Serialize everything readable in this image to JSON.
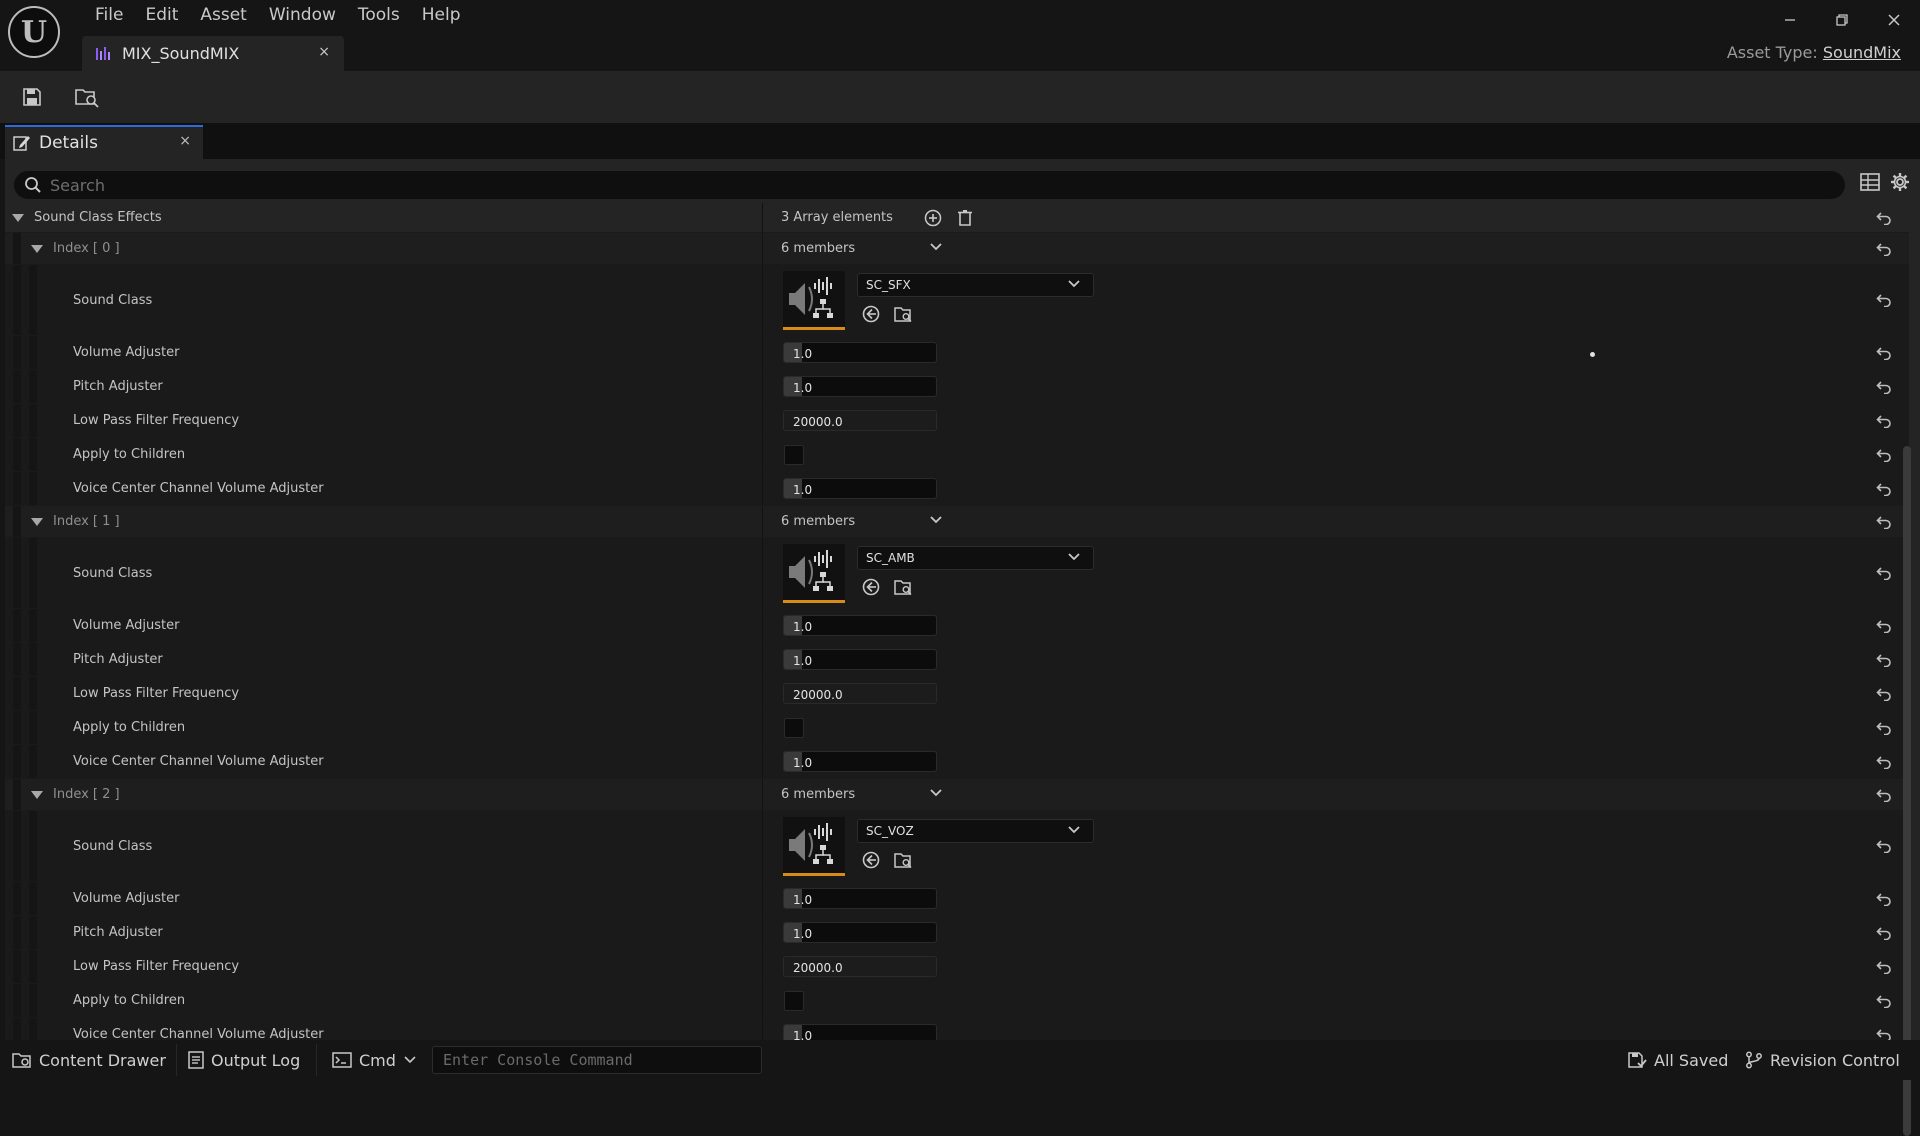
{
  "window": {
    "menu": [
      "File",
      "Edit",
      "Asset",
      "Window",
      "Tools",
      "Help"
    ],
    "doc_tab": {
      "label": "MIX_SoundMIX",
      "close": "×"
    },
    "asset_type_label": "Asset Type:",
    "asset_type_value": "SoundMix"
  },
  "details": {
    "tab_label": "Details",
    "tab_close": "×",
    "search_placeholder": "Search",
    "category": {
      "label": "Sound Class Effects",
      "value": "3 Array elements"
    },
    "row_labels": {
      "sound_class": "Sound Class",
      "volume": "Volume Adjuster",
      "pitch": "Pitch Adjuster",
      "lpf": "Low Pass Filter Frequency",
      "apply_children": "Apply to Children",
      "voice_center": "Voice Center Channel Volume Adjuster"
    },
    "elements": [
      {
        "index_label": "Index [ 0 ]",
        "members": "6 members",
        "sound_class": "SC_SFX",
        "volume": "1.0",
        "pitch": "1.0",
        "lpf": "20000.0",
        "apply_to_children": false,
        "voice_center": "1.0"
      },
      {
        "index_label": "Index [ 1 ]",
        "members": "6 members",
        "sound_class": "SC_AMB",
        "volume": "1.0",
        "pitch": "1.0",
        "lpf": "20000.0",
        "apply_to_children": false,
        "voice_center": "1.0"
      },
      {
        "index_label": "Index [ 2 ]",
        "members": "6 members",
        "sound_class": "SC_VOZ",
        "volume": "1.0",
        "pitch": "1.0",
        "lpf": "20000.0",
        "apply_to_children": false,
        "voice_center": "1.0"
      }
    ]
  },
  "statusbar": {
    "content_drawer": "Content Drawer",
    "output_log": "Output Log",
    "cmd": "Cmd",
    "console_placeholder": "Enter Console Command",
    "all_saved": "All Saved",
    "revision_control": "Revision Control"
  },
  "colors": {
    "accent_blue": "#2e6bd8",
    "thumbnail_underline": "#d88b17",
    "panel_bg": "#242424",
    "row_bg": "#1a1a1a"
  }
}
